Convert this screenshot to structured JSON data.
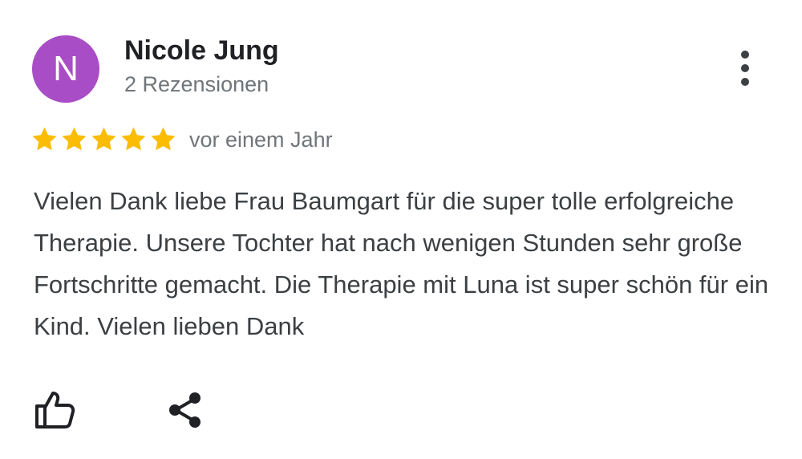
{
  "review": {
    "avatar_letter": "N",
    "avatar_color": "#a84dc5",
    "author_name": "Nicole Jung",
    "review_count": "2 Rezensionen",
    "rating": 5,
    "rating_max": 5,
    "star_color": "#fbbc04",
    "time_ago": "vor einem Jahr",
    "text": "Vielen Dank liebe Frau Baumgart für die super tolle erfolgreiche Therapie. Unsere Tochter hat nach wenigen Stunden sehr große Fortschritte gemacht. Die Therapie mit Luna ist super schön für ein Kind. Vielen lieben Dank"
  },
  "icons": {
    "more": "more-vert-icon",
    "like": "thumbs-up-icon",
    "share": "share-icon",
    "star": "star-icon"
  }
}
